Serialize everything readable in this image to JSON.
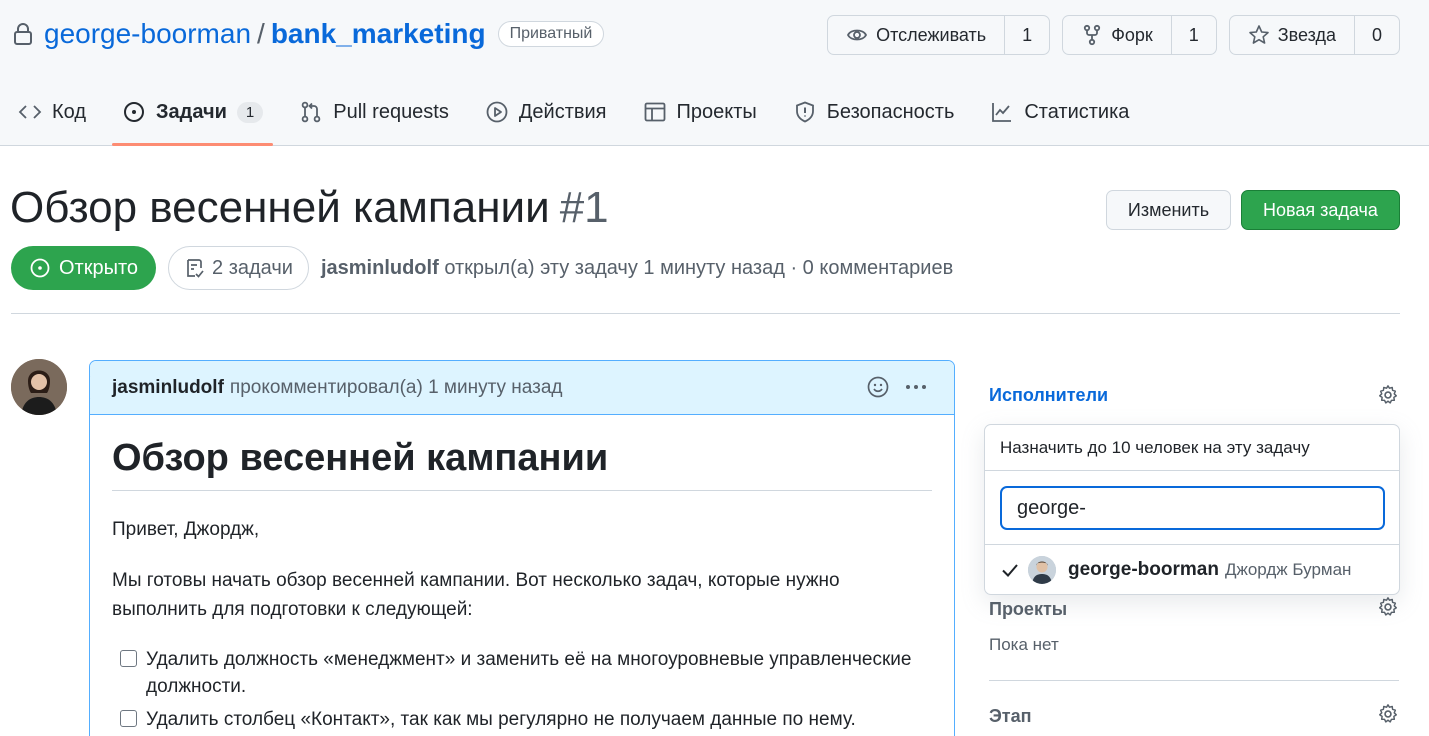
{
  "repo": {
    "owner": "george-boorman",
    "separator": "/",
    "name": "bank_marketing",
    "visibility": "Приватный"
  },
  "repo_actions": {
    "watch": {
      "label": "Отслеживать",
      "count": "1"
    },
    "fork": {
      "label": "Форк",
      "count": "1"
    },
    "star": {
      "label": "Звезда",
      "count": "0"
    }
  },
  "tabs": [
    {
      "label": "Код",
      "icon": "code-icon"
    },
    {
      "label": "Задачи",
      "icon": "issue-icon",
      "count": "1",
      "active": true
    },
    {
      "label": "Pull requests",
      "icon": "pull-request-icon"
    },
    {
      "label": "Действия",
      "icon": "play-icon"
    },
    {
      "label": "Проекты",
      "icon": "table-icon"
    },
    {
      "label": "Безопасность",
      "icon": "shield-icon"
    },
    {
      "label": "Статистика",
      "icon": "graph-icon"
    }
  ],
  "issue": {
    "title": "Обзор весенней кампании",
    "number": "#1",
    "edit_label": "Изменить",
    "new_label": "Новая задача",
    "state": "Открыто",
    "tasks": "2 задачи",
    "author": "jasminludolf",
    "opened_text": "открыл(а) эту задачу 1 минуту назад · 0 комментариев"
  },
  "comment": {
    "author": "jasminludolf",
    "action": "прокомментировал(а) 1 минуту назад",
    "heading": "Обзор весенней кампании",
    "greeting": "Привет, Джордж,",
    "intro": "Мы готовы начать обзор весенней кампании. Вот несколько задач, которые нужно выполнить для подготовки к следующей:",
    "tasks": [
      "Удалить должность «менеджмент» и заменить её на многоуровневые управленческие должности.",
      "Удалить столбец «Контакт», так как мы регулярно не получаем данные по нему."
    ]
  },
  "sidebar": {
    "assignees_label": "Исполнители",
    "popover_title": "Назначить до 10 человек на эту задачу",
    "search_value": "george-",
    "suggestion": {
      "login": "george-boorman",
      "name": "Джордж Бурман",
      "selected": true
    },
    "projects_label": "Проекты",
    "projects_value": "Пока нет",
    "milestone_label": "Этап"
  },
  "colors": {
    "link": "#0969da",
    "open_green": "#2da44e",
    "active_tab_underline": "#fd8c73",
    "comment_header": "#ddf4ff"
  }
}
